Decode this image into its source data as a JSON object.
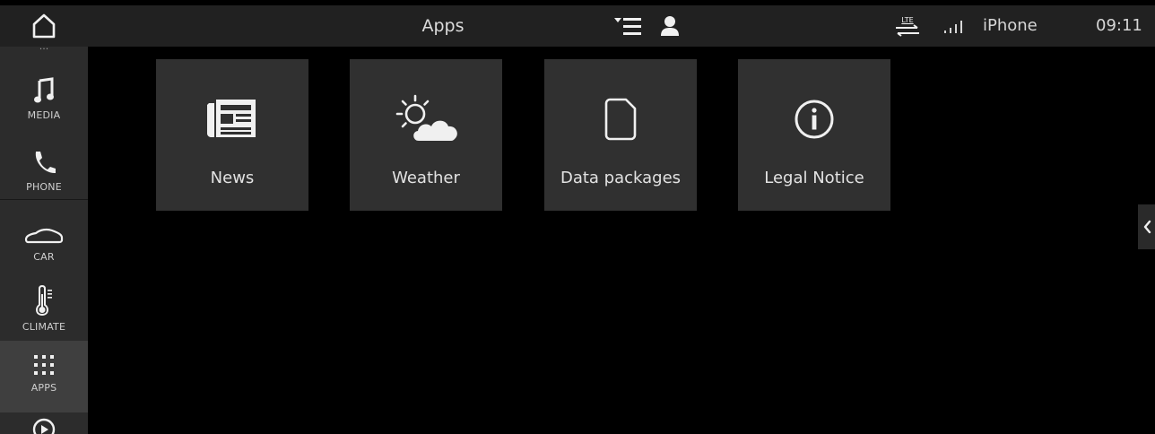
{
  "header": {
    "title": "Apps",
    "lte_label": "LTE",
    "device_name": "iPhone",
    "time": "09:11"
  },
  "sidebar": {
    "items": [
      {
        "label": "MEDIA",
        "icon": "music-note-icon"
      },
      {
        "label": "PHONE",
        "icon": "phone-icon"
      },
      {
        "label": "CAR",
        "icon": "car-icon"
      },
      {
        "label": "CLIMATE",
        "icon": "thermometer-icon"
      },
      {
        "label": "APPS",
        "icon": "apps-grid-icon",
        "active": true
      },
      {
        "label": "",
        "icon": "play-icon"
      }
    ]
  },
  "tiles": [
    {
      "label": "News",
      "icon": "news-icon"
    },
    {
      "label": "Weather",
      "icon": "weather-icon"
    },
    {
      "label": "Data packages",
      "icon": "document-icon"
    },
    {
      "label": "Legal Notice",
      "icon": "info-icon"
    }
  ],
  "colors": {
    "background": "#000000",
    "statusbar": "#212121",
    "sidebar": "#2c2c2c",
    "sidebar_active": "#3f3f3f",
    "tile": "#303030",
    "text": "#e2e2e2"
  }
}
